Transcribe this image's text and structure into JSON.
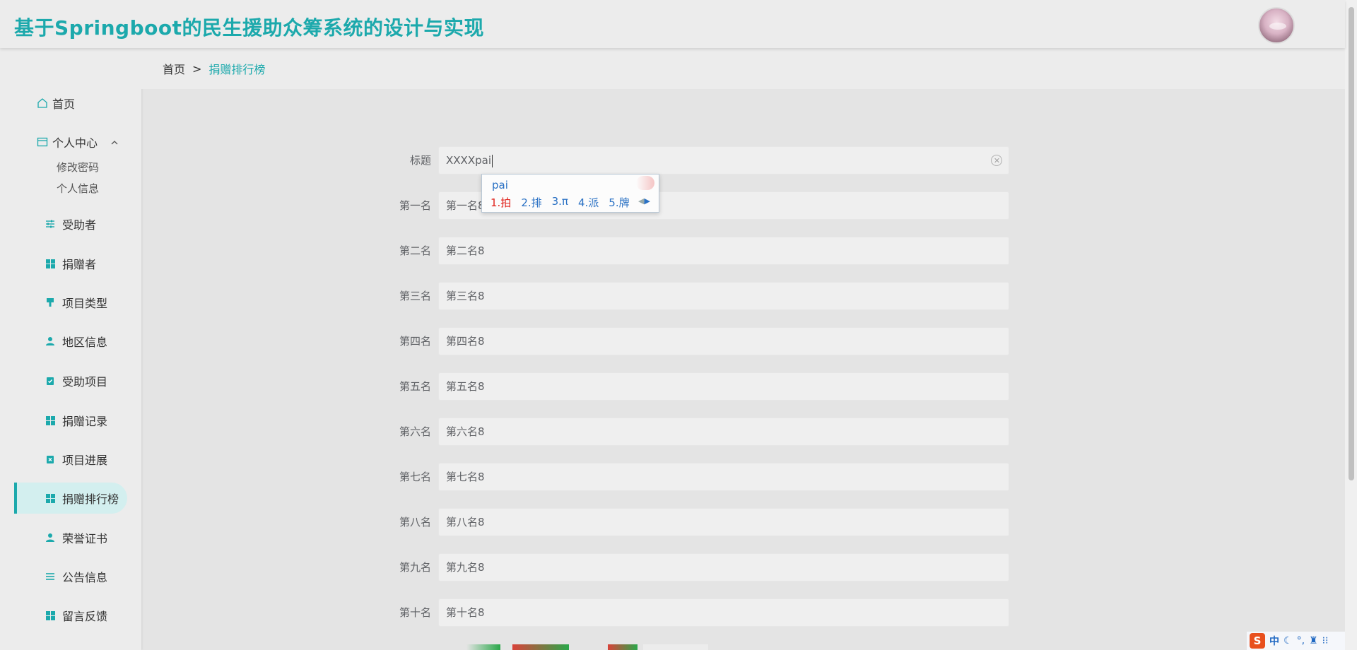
{
  "header": {
    "title": "基于Springboot的民生援助众筹系统的设计与实现"
  },
  "sidebar": {
    "home": "首页",
    "personal": {
      "label": "个人中心",
      "children": [
        "修改密码",
        "个人信息"
      ]
    },
    "items": [
      {
        "label": "受助者",
        "icon": "sliders-icon"
      },
      {
        "label": "捐赠者",
        "icon": "grid-icon"
      },
      {
        "label": "项目类型",
        "icon": "brush-icon"
      },
      {
        "label": "地区信息",
        "icon": "user-icon"
      },
      {
        "label": "受助项目",
        "icon": "clipboard-check-icon"
      },
      {
        "label": "捐赠记录",
        "icon": "grid-icon"
      },
      {
        "label": "项目进展",
        "icon": "clipboard-x-icon"
      },
      {
        "label": "捐赠排行榜",
        "icon": "grid-icon"
      },
      {
        "label": "荣誉证书",
        "icon": "user-icon"
      },
      {
        "label": "公告信息",
        "icon": "list-icon"
      },
      {
        "label": "留言反馈",
        "icon": "grid-icon"
      }
    ],
    "active_item": "捐赠排行榜",
    "accent_color": "#1ca9ac"
  },
  "breadcrumb": {
    "home": "首页",
    "separator": ">",
    "current": "捐赠排行榜"
  },
  "form": {
    "title": {
      "label": "标题",
      "value": "XXXXpai"
    },
    "ranks": [
      {
        "label": "第一名",
        "value": "第一名8"
      },
      {
        "label": "第二名",
        "value": "第二名8"
      },
      {
        "label": "第三名",
        "value": "第三名8"
      },
      {
        "label": "第四名",
        "value": "第四名8"
      },
      {
        "label": "第五名",
        "value": "第五名8"
      },
      {
        "label": "第六名",
        "value": "第六名8"
      },
      {
        "label": "第七名",
        "value": "第七名8"
      },
      {
        "label": "第八名",
        "value": "第八名8"
      },
      {
        "label": "第九名",
        "value": "第九名8"
      },
      {
        "label": "第十名",
        "value": "第十名8"
      }
    ]
  },
  "ime_popup": {
    "pinyin": "pai",
    "candidates": [
      "1.拍",
      "2.排",
      "3.π",
      "4.派",
      "5.牌"
    ]
  },
  "tray": {
    "logo": "S",
    "mode": "中"
  }
}
